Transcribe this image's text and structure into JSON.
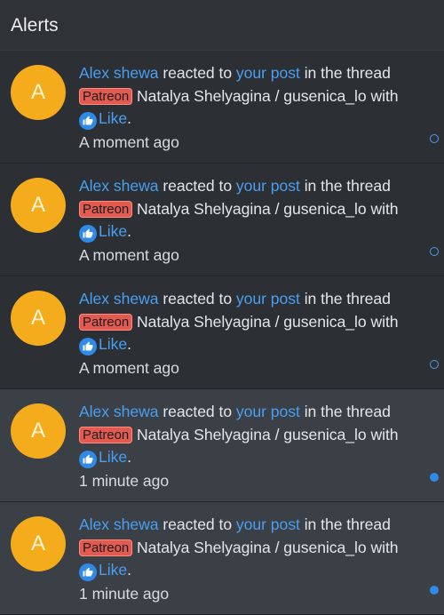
{
  "header": {
    "title": "Alerts"
  },
  "alerts": [
    {
      "avatar_letter": "A",
      "user": "Alex shewa",
      "reacted_to": "reacted to",
      "post_link": "your post",
      "in_thread": "in the thread",
      "prefix": "Patreon",
      "thread_title": "Natalya Shelyagina / gusenica_lo",
      "with": "with",
      "reaction": "Like",
      "period": ".",
      "time": "A moment ago",
      "read": true
    },
    {
      "avatar_letter": "A",
      "user": "Alex shewa",
      "reacted_to": "reacted to",
      "post_link": "your post",
      "in_thread": "in the thread",
      "prefix": "Patreon",
      "thread_title": "Natalya Shelyagina / gusenica_lo",
      "with": "with",
      "reaction": "Like",
      "period": ".",
      "time": "A moment ago",
      "read": true
    },
    {
      "avatar_letter": "A",
      "user": "Alex shewa",
      "reacted_to": "reacted to",
      "post_link": "your post",
      "in_thread": "in the thread",
      "prefix": "Patreon",
      "thread_title": "Natalya Shelyagina / gusenica_lo",
      "with": "with",
      "reaction": "Like",
      "period": ".",
      "time": "A moment ago",
      "read": true
    },
    {
      "avatar_letter": "A",
      "user": "Alex shewa",
      "reacted_to": "reacted to",
      "post_link": "your post",
      "in_thread": "in the thread",
      "prefix": "Patreon",
      "thread_title": "Natalya Shelyagina / gusenica_lo",
      "with": "with",
      "reaction": "Like",
      "period": ".",
      "time": "1 minute ago",
      "read": false
    },
    {
      "avatar_letter": "A",
      "user": "Alex shewa",
      "reacted_to": "reacted to",
      "post_link": "your post",
      "in_thread": "in the thread",
      "prefix": "Patreon",
      "thread_title": "Natalya Shelyagina / gusenica_lo",
      "with": "with",
      "reaction": "Like",
      "period": ".",
      "time": "1 minute ago",
      "read": false
    }
  ]
}
